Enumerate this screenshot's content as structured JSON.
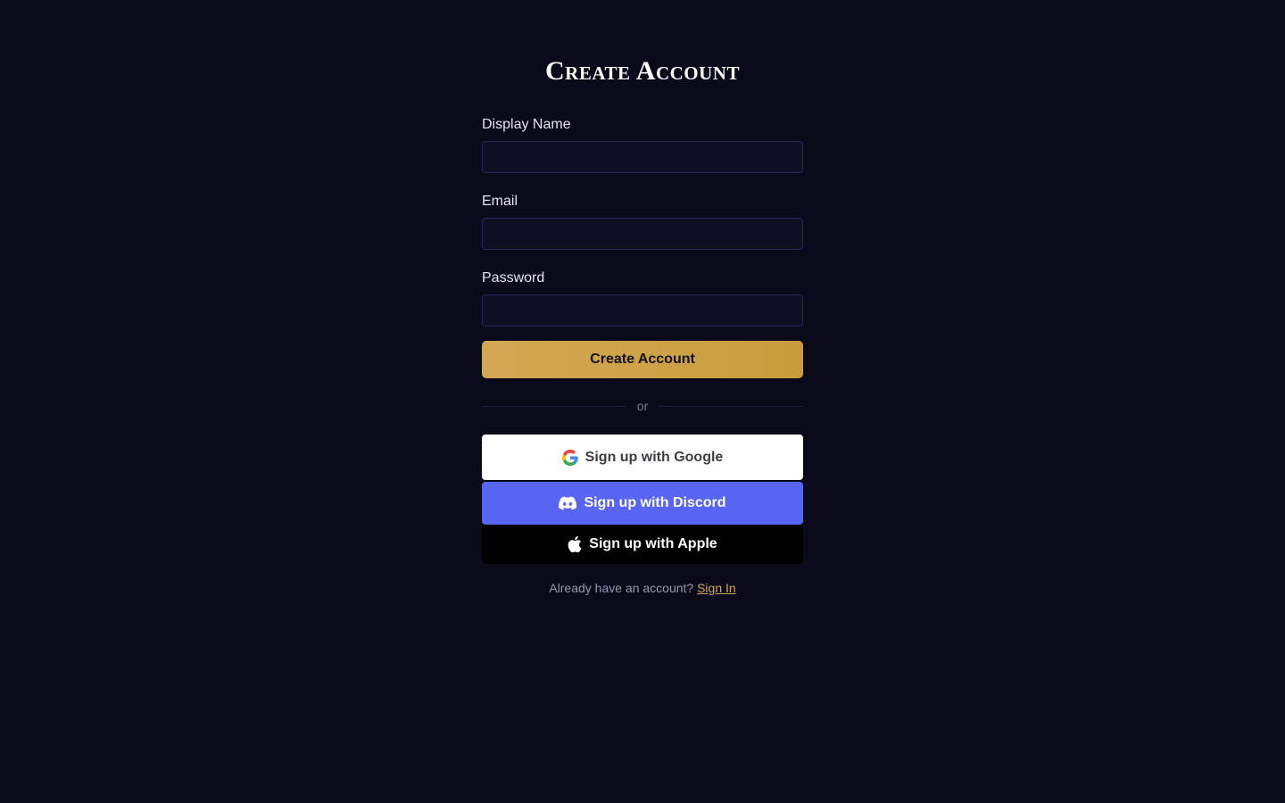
{
  "page": {
    "title": "Create Account"
  },
  "form": {
    "fields": [
      {
        "label": "Display Name",
        "value": "",
        "placeholder": ""
      },
      {
        "label": "Email",
        "value": "",
        "placeholder": ""
      },
      {
        "label": "Password",
        "value": "",
        "placeholder": ""
      }
    ],
    "submit_label": "Create Account"
  },
  "divider": {
    "text": "or"
  },
  "social": {
    "google": {
      "label": "Sign up with Google",
      "icon": "google-icon"
    },
    "discord": {
      "label": "Sign up with Discord",
      "icon": "discord-icon"
    },
    "apple": {
      "label": "Sign up with Apple",
      "icon": "apple-icon"
    }
  },
  "footer": {
    "prompt": "Already have an account?",
    "link_label": "Sign In"
  },
  "colors": {
    "background": "#0b0a1a",
    "accent": "#d4a853",
    "discord": "#5865f2",
    "input_border": "#2d2560"
  }
}
